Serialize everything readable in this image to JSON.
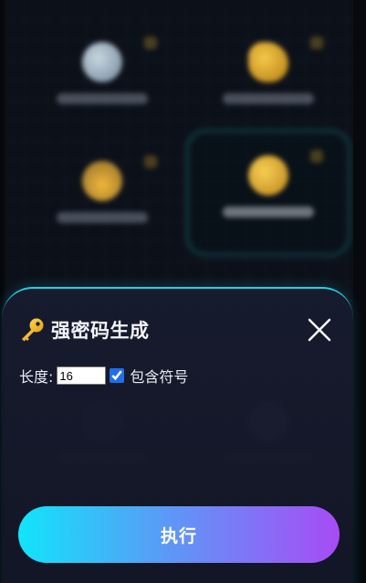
{
  "colors": {
    "accent_cyan": "#1fd3e6",
    "gradient_start": "#11e4fa",
    "gradient_end": "#a84bf5",
    "key_gold": "#f5b820",
    "text_primary": "#f2f4fa"
  },
  "modal": {
    "icon": "key-icon",
    "title": "强密码生成",
    "close_icon": "close-icon"
  },
  "options": {
    "length_label": "长度:",
    "length_value": "16",
    "include_symbols_checked": true,
    "include_symbols_label": "包含符号"
  },
  "actions": {
    "execute_label": "执行"
  }
}
